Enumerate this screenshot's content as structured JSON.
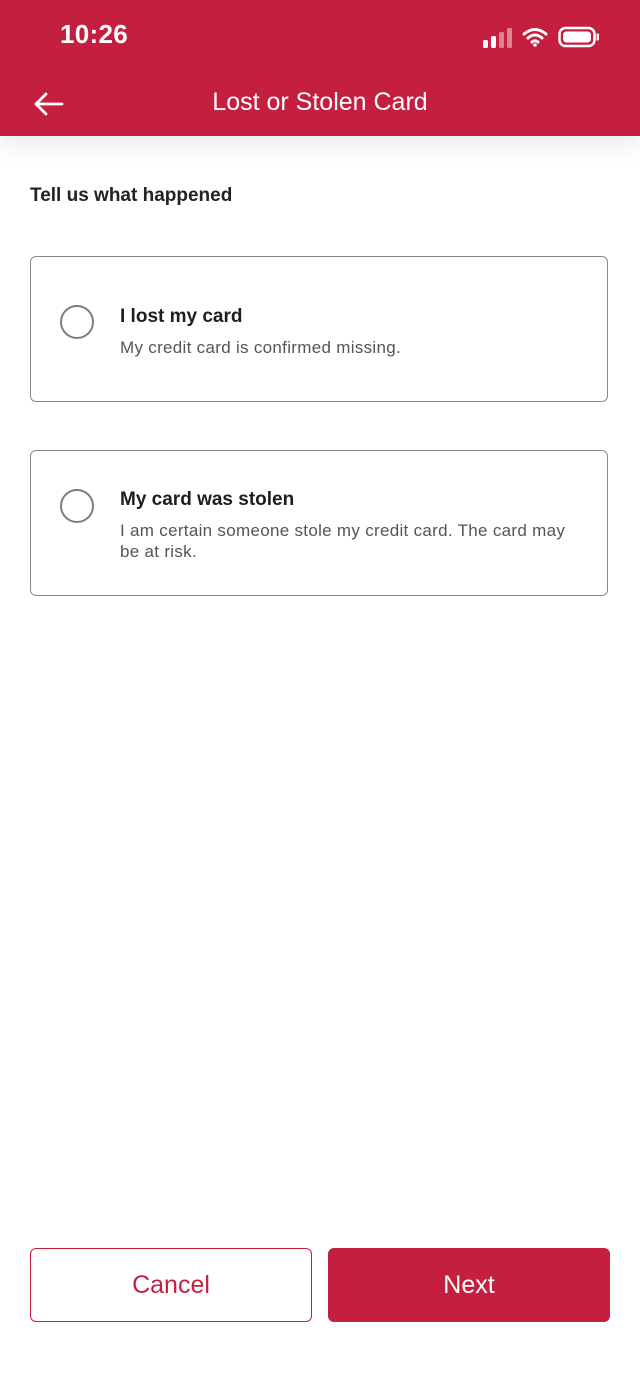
{
  "status_bar": {
    "time": "10:26",
    "icons": [
      "signal-icon",
      "wifi-icon",
      "battery-icon"
    ]
  },
  "nav": {
    "back_icon": "arrow-left-icon",
    "title": "Lost or Stolen Card"
  },
  "form": {
    "prompt": "Tell us what happened",
    "options": [
      {
        "title": "I lost my card",
        "description": "My credit card is confirmed missing.",
        "selected": false
      },
      {
        "title": "My card was stolen",
        "description": "I am certain someone stole my credit card. The card may be at risk.",
        "selected": false
      }
    ]
  },
  "footer": {
    "cancel_label": "Cancel",
    "next_label": "Next"
  },
  "colors": {
    "brand": "#c41f3e",
    "text": "#222222",
    "muted_text": "#555555",
    "border": "#8a8a8a"
  }
}
